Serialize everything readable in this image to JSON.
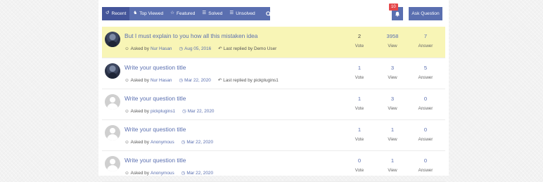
{
  "colors": {
    "accent": "#5a6fb0",
    "accent_active": "#44559a",
    "featured_bg": "#f8f5b6",
    "badge": "#e5474a"
  },
  "nav": {
    "items": [
      {
        "icon": "history-icon",
        "glyph": "↺",
        "label": "Recent"
      },
      {
        "icon": "binoculars-icon",
        "glyph": "♞",
        "label": "Top Viewed"
      },
      {
        "icon": "star-icon",
        "glyph": "☆",
        "label": "Featured"
      },
      {
        "icon": "list-icon",
        "glyph": "☰",
        "label": "Solved"
      },
      {
        "icon": "list-icon",
        "glyph": "☰",
        "label": "Unsolved"
      }
    ],
    "search_icon": "search-icon"
  },
  "notifications": {
    "count": "10",
    "icon": "bell-icon"
  },
  "ask_button": "Ask Question",
  "stat_labels": {
    "vote": "Vote",
    "view": "View",
    "answer": "Answer"
  },
  "questions": [
    {
      "featured": true,
      "avatar": "photo",
      "title": "But I must explain to you how all this mistaken idea",
      "asked_by": "Asked by",
      "author": "Nur Hasan",
      "date": "Aug 05, 2016",
      "last_replied": "Last replied by Demo User",
      "votes": "2",
      "views": "3958",
      "answers": "7"
    },
    {
      "featured": false,
      "avatar": "photo",
      "title": "Write your question title",
      "asked_by": "Asked by",
      "author": "Nur Hasan",
      "date": "Mar 22, 2020",
      "last_replied": "Last replied by pickplugins1",
      "votes": "1",
      "views": "3",
      "answers": "5"
    },
    {
      "featured": false,
      "avatar": "blank",
      "title": "Write your question title",
      "asked_by": "Asked by",
      "author": "pickplugins1",
      "date": "Mar 22, 2020",
      "last_replied": "",
      "votes": "1",
      "views": "3",
      "answers": "0"
    },
    {
      "featured": false,
      "avatar": "blank",
      "title": "Write your question title",
      "asked_by": "Asked by",
      "author": "Anonymous",
      "date": "Mar 22, 2020",
      "last_replied": "",
      "votes": "1",
      "views": "1",
      "answers": "0"
    },
    {
      "featured": false,
      "avatar": "blank",
      "title": "Write your question title",
      "asked_by": "Asked by",
      "author": "Anonymous",
      "date": "Mar 22, 2020",
      "last_replied": "",
      "votes": "0",
      "views": "1",
      "answers": "0"
    }
  ]
}
